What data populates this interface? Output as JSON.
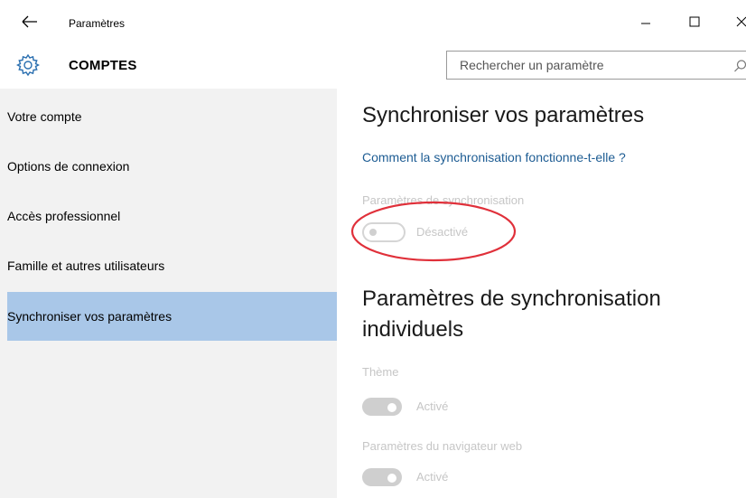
{
  "window": {
    "title": "Paramètres"
  },
  "header": {
    "section_title": "COMPTES",
    "search_placeholder": "Rechercher un paramètre"
  },
  "sidebar": {
    "items": [
      {
        "label": "Votre compte"
      },
      {
        "label": "Options de connexion"
      },
      {
        "label": "Accès professionnel"
      },
      {
        "label": "Famille et autres utilisateurs"
      },
      {
        "label": "Synchroniser vos paramètres",
        "selected": true
      }
    ]
  },
  "main": {
    "title": "Synchroniser vos paramètres",
    "help_link": "Comment la synchronisation fonctionne-t-elle ?",
    "sync_settings": {
      "label": "Paramètres de synchronisation",
      "state": "Désactivé",
      "on": false
    },
    "individual_title": "Paramètres de synchronisation individuels",
    "individual": [
      {
        "label": "Thème",
        "state": "Activé",
        "on": true
      },
      {
        "label": "Paramètres du navigateur web",
        "state": "Activé",
        "on": true
      }
    ]
  },
  "colors": {
    "accent_selected": "#a9c7e8",
    "link": "#1d5c93",
    "annotation": "#e0303a",
    "sidebar_bg": "#f2f2f2"
  },
  "icons": [
    "back-arrow-icon",
    "gear-icon",
    "minimize-icon",
    "maximize-icon",
    "close-icon",
    "search-icon"
  ]
}
